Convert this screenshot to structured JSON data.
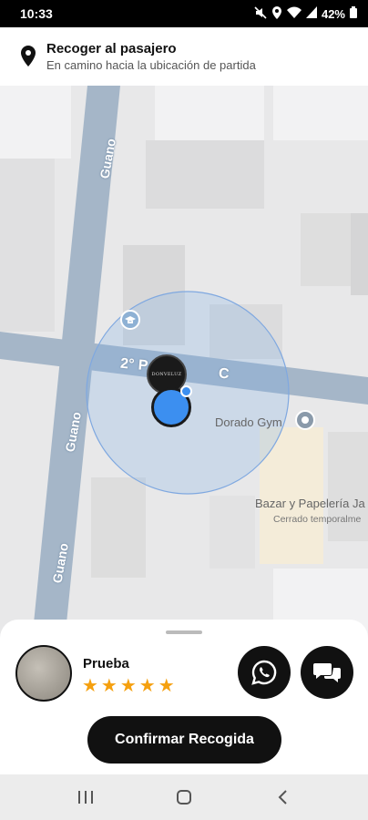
{
  "status_bar": {
    "time": "10:33",
    "battery": "42%",
    "icons": [
      "mute-icon",
      "location-icon",
      "wifi-icon",
      "signal-icon",
      "battery-icon"
    ]
  },
  "header": {
    "title": "Recoger al pasajero",
    "subtitle": "En camino hacia la ubicación de partida"
  },
  "map": {
    "road_labels": [
      "Guano",
      "Guano",
      "Guano",
      "2° P",
      "C"
    ],
    "places": [
      {
        "name": "Dorado Gym"
      },
      {
        "name": "Bazar y Papelería Ja",
        "status": "Cerrado temporalme"
      }
    ],
    "marker_text": "DONVELUZ"
  },
  "sheet": {
    "driver_name": "Prueba",
    "rating": 5,
    "stars": "★★★★★",
    "confirm_label": "Confirmar Recogida"
  },
  "colors": {
    "accent": "#111111",
    "star": "#f5a00f",
    "location_dot": "#3c8ff0",
    "road": "#a5b6c8"
  }
}
